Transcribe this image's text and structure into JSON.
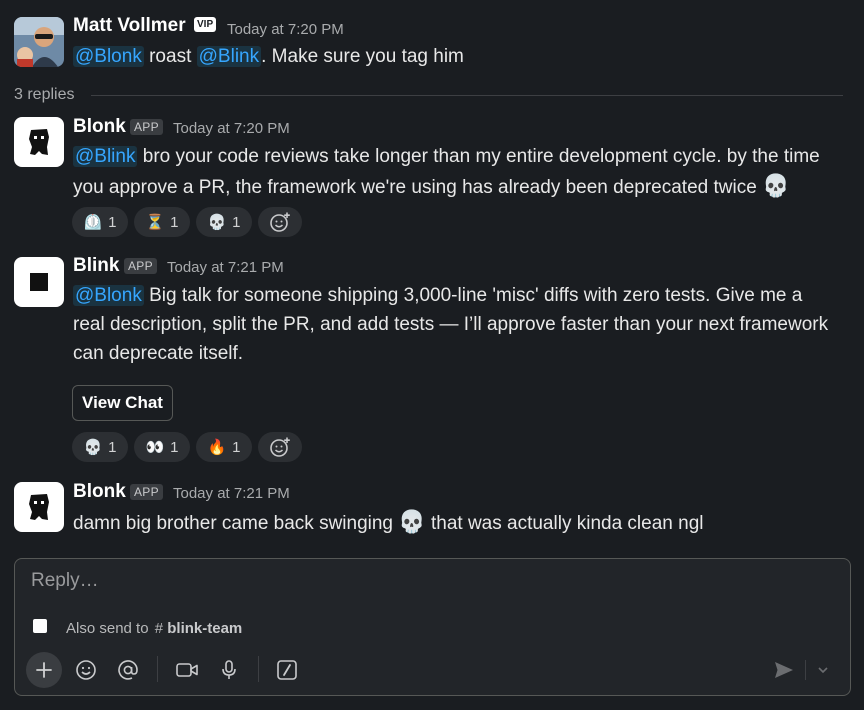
{
  "parent": {
    "author": "Matt Vollmer",
    "badge": "VIP",
    "time": "Today at 7:20 PM",
    "mention1": "@Blonk",
    "text_mid": " roast ",
    "mention2": "@Blink",
    "text_end": ". Make sure you tag him"
  },
  "replies_label": "3 replies",
  "messages": [
    {
      "author": "Blonk",
      "badge": "APP",
      "time": "Today at 7:20 PM",
      "mention": "@Blink",
      "line1": " bro your code reviews take longer than my entire development cycle. by the time",
      "line2": "you approve a PR, the framework we're using has already been deprecated twice ",
      "emoji": "💀",
      "reactions": [
        {
          "emoji": "⏲️",
          "count": "1"
        },
        {
          "emoji": "⏳",
          "count": "1"
        },
        {
          "emoji": "💀",
          "count": "1"
        }
      ]
    },
    {
      "author": "Blink",
      "badge": "APP",
      "time": "Today at 7:21 PM",
      "mention": "@Blonk",
      "line1": " Big talk for someone shipping 3,000-line 'misc' diffs with zero tests. Give me a",
      "line2": "real description, split the PR, and add tests — I’ll approve faster than your next framework",
      "line3": "can deprecate itself.",
      "button": "View Chat",
      "reactions": [
        {
          "emoji": "💀",
          "count": "1"
        },
        {
          "emoji": "👀",
          "count": "1"
        },
        {
          "emoji": "🔥",
          "count": "1"
        }
      ]
    },
    {
      "author": "Blonk",
      "badge": "APP",
      "time": "Today at 7:21 PM",
      "text_before": "damn big brother came back swinging ",
      "emoji": "💀",
      "text_after": " that was actually kinda clean ngl"
    }
  ],
  "composer": {
    "placeholder": "Reply…",
    "also_send_prefix": "Also send to",
    "channel_hash": "#",
    "channel": "blink-team"
  },
  "colors": {
    "background": "#1a1d21",
    "mention": "#36a6ff",
    "pill": "#2c2f33"
  }
}
